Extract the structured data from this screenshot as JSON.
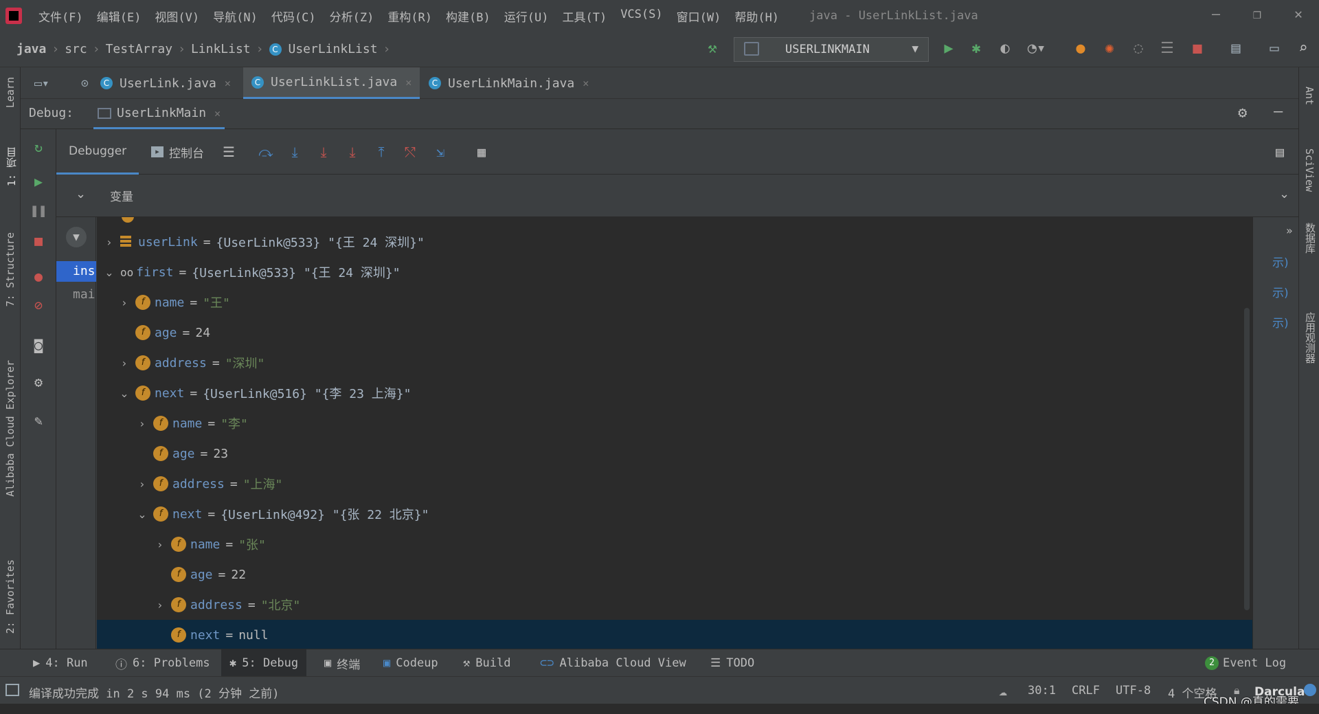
{
  "menubar": {
    "items": [
      "文件(F)",
      "编辑(E)",
      "视图(V)",
      "导航(N)",
      "代码(C)",
      "分析(Z)",
      "重构(R)",
      "构建(B)",
      "运行(U)",
      "工具(T)",
      "VCS(S)",
      "窗口(W)",
      "帮助(H)"
    ],
    "window_title": "java - UserLinkList.java",
    "minimize": "—",
    "restore": "❐",
    "close": "✕"
  },
  "breadcrumb": {
    "items": [
      "java",
      "src",
      "TestArray",
      "LinkList",
      "UserLinkList"
    ]
  },
  "run_config": {
    "label": "USERLINKMAIN"
  },
  "editor_tabs": [
    {
      "label": "UserLink.java"
    },
    {
      "label": "UserLinkList.java"
    },
    {
      "label": "UserLinkMain.java"
    }
  ],
  "debug": {
    "label": "Debug:",
    "session_tab": "UserLinkMain",
    "tabs": {
      "debugger": "Debugger",
      "console": "控制台"
    },
    "variables_header": "变量",
    "frames": [
      "ins",
      "mai"
    ],
    "right_hints": [
      "示)",
      "示)",
      "示)"
    ]
  },
  "variables": [
    {
      "name": "userLink",
      "value": "{UserLink@533} \"{王 24 深圳}\"",
      "type": "obj"
    },
    {
      "name": "first",
      "value": "{UserLink@533} \"{王 24 深圳}\"",
      "type": "obj"
    },
    {
      "name": "name",
      "value": "\"王\"",
      "type": "str"
    },
    {
      "name": "age",
      "value": "24",
      "type": "num"
    },
    {
      "name": "address",
      "value": "\"深圳\"",
      "type": "str"
    },
    {
      "name": "next",
      "value": "{UserLink@516} \"{李 23 上海}\"",
      "type": "obj"
    },
    {
      "name": "name",
      "value": "\"李\"",
      "type": "str"
    },
    {
      "name": "age",
      "value": "23",
      "type": "num"
    },
    {
      "name": "address",
      "value": "\"上海\"",
      "type": "str"
    },
    {
      "name": "next",
      "value": "{UserLink@492} \"{张 22 北京}\"",
      "type": "obj"
    },
    {
      "name": "name",
      "value": "\"张\"",
      "type": "str"
    },
    {
      "name": "age",
      "value": "22",
      "type": "num"
    },
    {
      "name": "address",
      "value": "\"北京\"",
      "type": "str"
    },
    {
      "name": "next",
      "value": "null",
      "type": "num"
    }
  ],
  "left_strip": {
    "learn": "Learn",
    "project": "1: 项目",
    "structure": "7: Structure",
    "alibaba": "Alibaba Cloud Explorer",
    "favorites": "2: Favorites"
  },
  "right_strip": {
    "ant": "Ant",
    "sciview": "SciView",
    "database": "数据库",
    "app_observer": "应用观测器"
  },
  "bottom_tabs": {
    "run": "4: Run",
    "problems": "6: Problems",
    "debug": "5: Debug",
    "terminal": "终端",
    "codeup": "Codeup",
    "build": "Build",
    "alibaba_view": "Alibaba Cloud View",
    "todo": "TODO",
    "event_log_count": "2",
    "event_log": "Event Log"
  },
  "status": {
    "message": "编译成功完成 in 2 s 94 ms (2 分钟 之前)",
    "position": "30:1",
    "line_ending": "CRLF",
    "encoding": "UTF-8",
    "indent": "4 个空格",
    "theme": "Darcula",
    "watermark": "CSDN @真的需要"
  }
}
